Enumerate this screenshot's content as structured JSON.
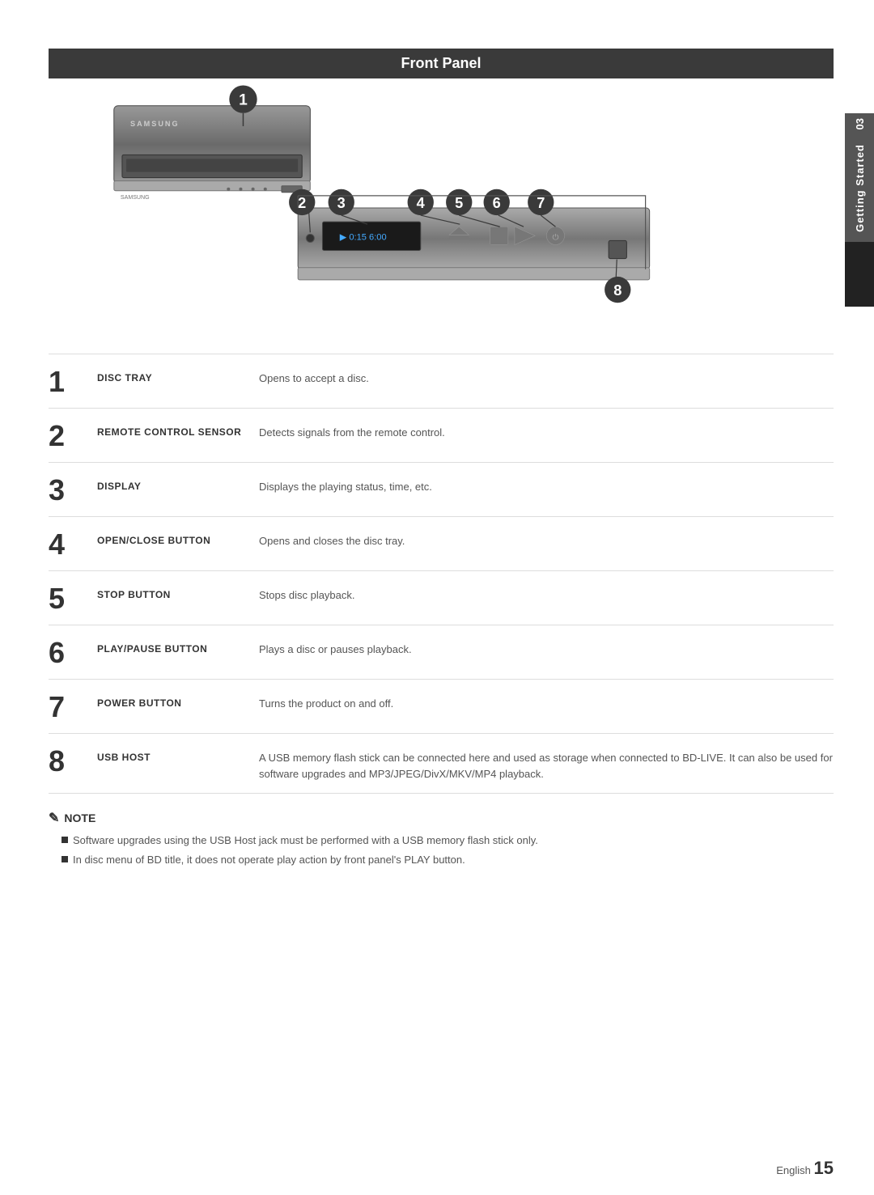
{
  "page": {
    "title": "Front Panel",
    "chapter_number": "03",
    "chapter_label": "Getting Started",
    "page_number": "15",
    "page_prefix": "English"
  },
  "diagram": {
    "num1_label": "1",
    "num2_label": "2",
    "num3_label": "3",
    "num4_label": "4",
    "num5_label": "5",
    "num6_label": "6",
    "num7_label": "7",
    "num8_label": "8",
    "display_text": "0:15 6:00"
  },
  "items": [
    {
      "number": "1",
      "label": "DISC TRAY",
      "description": "Opens to accept a disc."
    },
    {
      "number": "2",
      "label": "REMOTE CONTROL SENSOR",
      "description": "Detects signals from the remote control."
    },
    {
      "number": "3",
      "label": "DISPLAY",
      "description": "Displays the playing status, time, etc."
    },
    {
      "number": "4",
      "label": "OPEN/CLOSE BUTTON",
      "description": "Opens and closes the disc tray."
    },
    {
      "number": "5",
      "label": "STOP BUTTON",
      "description": "Stops disc playback."
    },
    {
      "number": "6",
      "label": "PLAY/PAUSE BUTTON",
      "description": "Plays a disc or pauses playback."
    },
    {
      "number": "7",
      "label": "POWER BUTTON",
      "description": "Turns the product on and off."
    },
    {
      "number": "8",
      "label": "USB HOST",
      "description": "A USB memory flash stick can be connected here and used as storage when connected to BD-LIVE. It can also be used for software upgrades and MP3/JPEG/DivX/MKV/MP4 playback."
    }
  ],
  "note": {
    "title": "NOTE",
    "items": [
      "Software upgrades using the USB Host jack must be performed with a USB memory flash stick only.",
      "In disc menu of BD title, it does not operate play action by front panel's PLAY button."
    ]
  }
}
